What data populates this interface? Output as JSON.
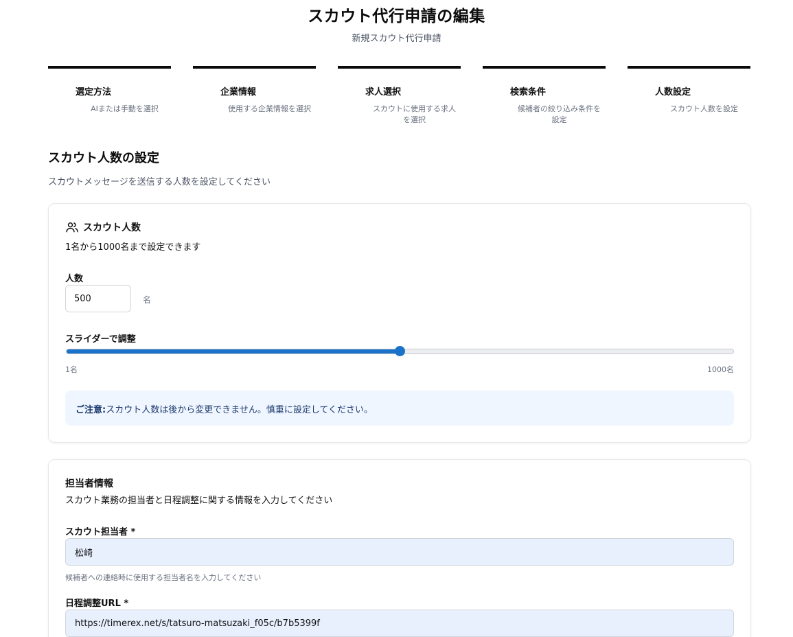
{
  "header": {
    "title": "スカウト代行申請の編集",
    "subtitle": "新規スカウト代行申請"
  },
  "steps": [
    {
      "label": "選定方法",
      "desc": "AIまたは手動を選択"
    },
    {
      "label": "企業情報",
      "desc": "使用する企業情報を選択"
    },
    {
      "label": "求人選択",
      "desc": "スカウトに使用する求人を選択"
    },
    {
      "label": "検索条件",
      "desc": "候補者の絞り込み条件を設定"
    },
    {
      "label": "人数設定",
      "desc": "スカウト人数を設定"
    }
  ],
  "section": {
    "title": "スカウト人数の設定",
    "desc": "スカウトメッセージを送信する人数を設定してください"
  },
  "count_card": {
    "icon": "users-icon",
    "title": "スカウト人数",
    "desc": "1名から1000名まで設定できます",
    "count_label": "人数",
    "count_value": "500",
    "unit": "名",
    "slider_label": "スライダーで調整",
    "slider_value": 500,
    "slider_min": 1,
    "slider_max": 1000,
    "min_label": "1名",
    "max_label": "1000名",
    "notice_strong": "ご注意:",
    "notice_text": "スカウト人数は後から変更できません。慎重に設定してください。",
    "accent_color": "#1a73c8"
  },
  "contact_card": {
    "title": "担当者情報",
    "desc": "スカウト業務の担当者と日程調整に関する情報を入力してください",
    "person_label": "スカウト担当者 *",
    "person_value": "松崎",
    "person_help": "候補者への連絡時に使用する担当者名を入力してください",
    "url_label": "日程調整URL *",
    "url_value": "https://timerex.net/s/tatsuro-matsuzaki_f05c/b7b5399f"
  }
}
